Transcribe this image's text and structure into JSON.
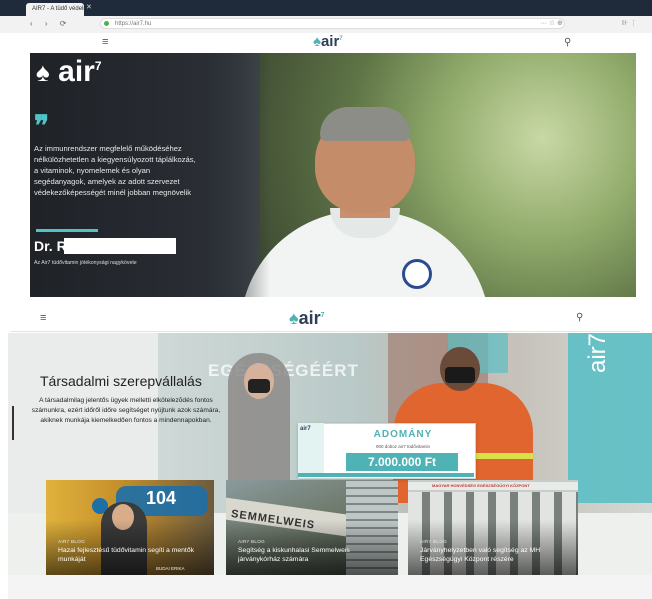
{
  "browser": {
    "tab_title": "AIR7 - A tüdő védelmében",
    "url": "https://air7.hu",
    "nav_glyphs": "‹ › ⟳",
    "addr_icons": "··· ☆ ⊕",
    "right_icons": "⊪ ⋮"
  },
  "header": {
    "menu_icon": "≡",
    "logo": "air",
    "logo_sup": "7",
    "user_icon": "⚲"
  },
  "hero": {
    "logo": "air",
    "logo_sup": "7",
    "quote_mark": "❞",
    "quote": "Az immunrendszer megfelelő működéséhez nélkülözhetetlen a kiegyensúlyozott táplálkozás, a vitaminok, nyomelemek és olyan segédanyagok, amelyek az adott szervezet védekezőképességét minél jobban megnövelik",
    "name": "Dr. R",
    "caption": "Az Air7 tüdővitamin jótékonysági nagykövete"
  },
  "section2": {
    "watermark": "EGÉSZSÉGÉÉRT",
    "title": "Társadalmi szerepvállalás",
    "text": "A társadalmilag jelentős ügyek melletti elkötelezõdés fontos számunkra, ezért időről időre segítséget nyújtunk azok számára, akiknek munkája kiemelkedően fontos a mindennapokban.",
    "banner_text": "air7",
    "check": {
      "logo": "air7",
      "title": "ADOMÁNY",
      "sub": "900 doboz air7 tüdővitamin",
      "amount": "7.000.000 Ft"
    },
    "cards": [
      {
        "tag": "AIR7 BLOG",
        "title": "Hazai fejlesztésű tüdővitamin segíti a mentők munkáját",
        "extra": "104",
        "author": "BUDAI ERIKA"
      },
      {
        "tag": "AIR7 BLOG",
        "title": "Segítség a kiskunhalasi Semmelweis járványkórház számára",
        "extra": "SEMMELWEIS"
      },
      {
        "tag": "AIR7 BLOG",
        "title": "Járványhelyzetben való segítség az MH Egészségügyi Központ részére",
        "extra": "MAGYAR HONVÉDSÉG EGÉSZSÉGÜGYI KÖZPONT"
      }
    ]
  },
  "colors": {
    "accent": "#4fb3b6",
    "brand_dark": "#2e3f57"
  }
}
